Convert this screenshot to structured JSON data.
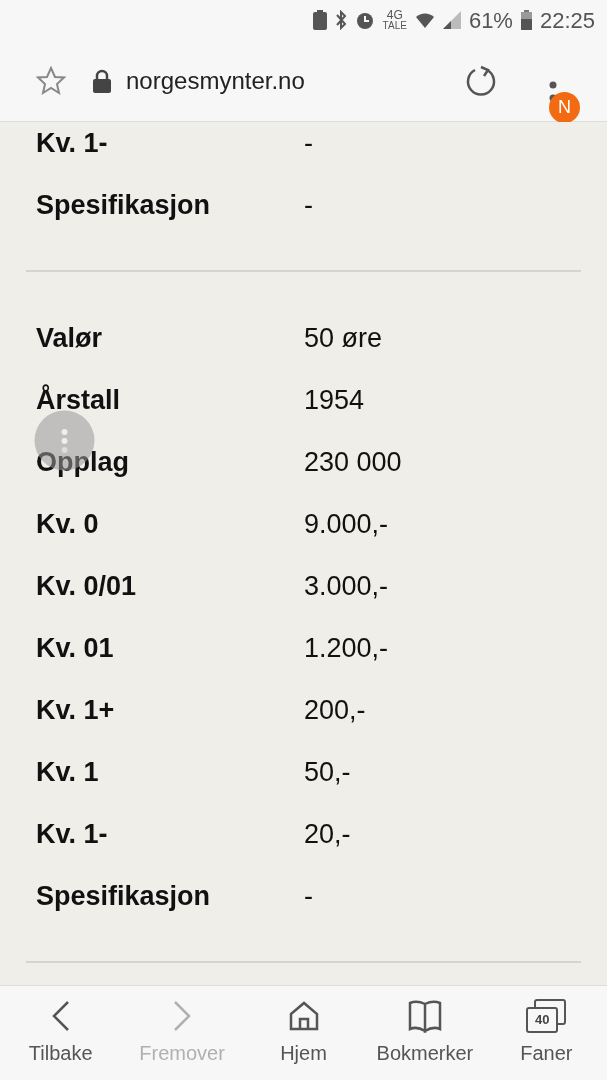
{
  "status_bar": {
    "network_top": "4G",
    "network_bottom": "TALE",
    "battery": "61%",
    "time": "22:25"
  },
  "address_bar": {
    "url": "norgesmynter.no",
    "notification_badge": "N"
  },
  "sections": [
    {
      "rows": [
        {
          "label": "Kv. 1-",
          "value": "-"
        },
        {
          "label": "Spesifikasjon",
          "value": "-"
        }
      ]
    },
    {
      "rows": [
        {
          "label": "Valør",
          "value": "50 øre"
        },
        {
          "label": "Årstall",
          "value": "1954"
        },
        {
          "label": "Opplag",
          "value": "230 000"
        },
        {
          "label": "Kv. 0",
          "value": "9.000,-"
        },
        {
          "label": "Kv. 0/01",
          "value": "3.000,-"
        },
        {
          "label": "Kv. 01",
          "value": "1.200,-"
        },
        {
          "label": "Kv. 1+",
          "value": "200,-"
        },
        {
          "label": "Kv. 1",
          "value": "50,-"
        },
        {
          "label": "Kv. 1-",
          "value": "20,-"
        },
        {
          "label": "Spesifikasjon",
          "value": "-"
        }
      ]
    }
  ],
  "bottom_nav": [
    {
      "kind": "back",
      "label": "Tilbake",
      "disabled": false
    },
    {
      "kind": "forward",
      "label": "Fremover",
      "disabled": true
    },
    {
      "kind": "home",
      "label": "Hjem",
      "disabled": false
    },
    {
      "kind": "bookmarks",
      "label": "Bokmerker",
      "disabled": false
    },
    {
      "kind": "tabs",
      "label": "Faner",
      "count": "40",
      "disabled": false
    }
  ]
}
